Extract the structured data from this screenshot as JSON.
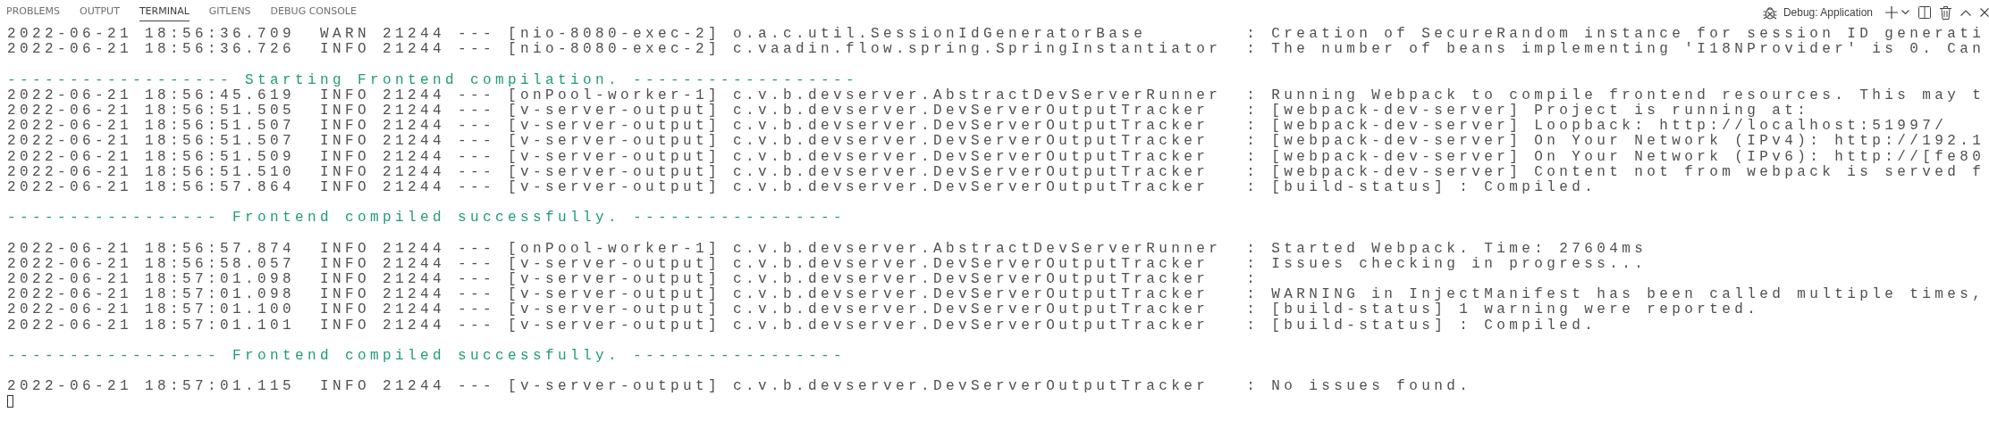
{
  "tabs": [
    {
      "label": "PROBLEMS",
      "selected": false
    },
    {
      "label": "OUTPUT",
      "selected": false
    },
    {
      "label": "TERMINAL",
      "selected": true
    },
    {
      "label": "GITLENS",
      "selected": false
    },
    {
      "label": "DEBUG CONSOLE",
      "selected": false
    }
  ],
  "toolbar": {
    "session": "Debug: Application"
  },
  "terminal": {
    "lines": [
      {
        "kind": "log",
        "text": "2022-06-21 18:56:36.709  WARN 21244 --- [nio-8080-exec-2] o.a.c.util.SessionIdGeneratorBase        : Creation of SecureRandom instance for session ID generati"
      },
      {
        "kind": "log",
        "text": "2022-06-21 18:56:36.726  INFO 21244 --- [nio-8080-exec-2] c.vaadin.flow.spring.SpringInstantiator  : The number of beans implementing 'I18NProvider' is 0. Can"
      },
      {
        "kind": "blank"
      },
      {
        "kind": "banner",
        "text": "------------------ Starting Frontend compilation. ------------------"
      },
      {
        "kind": "log",
        "text": "2022-06-21 18:56:45.619  INFO 21244 --- [onPool-worker-1] c.v.b.devserver.AbstractDevServerRunner  : Running Webpack to compile frontend resources. This may t"
      },
      {
        "kind": "log",
        "text": "2022-06-21 18:56:51.505  INFO 21244 --- [v-server-output] c.v.b.devserver.DevServerOutputTracker   : [webpack-dev-server] Project is running at:"
      },
      {
        "kind": "log",
        "text": "2022-06-21 18:56:51.507  INFO 21244 --- [v-server-output] c.v.b.devserver.DevServerOutputTracker   : [webpack-dev-server] Loopback: http://localhost:51997/"
      },
      {
        "kind": "log",
        "text": "2022-06-21 18:56:51.507  INFO 21244 --- [v-server-output] c.v.b.devserver.DevServerOutputTracker   : [webpack-dev-server] On Your Network (IPv4): http://192.1"
      },
      {
        "kind": "log",
        "text": "2022-06-21 18:56:51.509  INFO 21244 --- [v-server-output] c.v.b.devserver.DevServerOutputTracker   : [webpack-dev-server] On Your Network (IPv6): http://[fe80"
      },
      {
        "kind": "log",
        "text": "2022-06-21 18:56:51.510  INFO 21244 --- [v-server-output] c.v.b.devserver.DevServerOutputTracker   : [webpack-dev-server] Content not from webpack is served f"
      },
      {
        "kind": "log",
        "text": "2022-06-21 18:56:57.864  INFO 21244 --- [v-server-output] c.v.b.devserver.DevServerOutputTracker   : [build-status] : Compiled."
      },
      {
        "kind": "blank"
      },
      {
        "kind": "banner",
        "text": "----------------- Frontend compiled successfully. -----------------"
      },
      {
        "kind": "blank"
      },
      {
        "kind": "log",
        "text": "2022-06-21 18:56:57.874  INFO 21244 --- [onPool-worker-1] c.v.b.devserver.AbstractDevServerRunner  : Started Webpack. Time: 27604ms"
      },
      {
        "kind": "log",
        "text": "2022-06-21 18:56:58.057  INFO 21244 --- [v-server-output] c.v.b.devserver.DevServerOutputTracker   : Issues checking in progress..."
      },
      {
        "kind": "log",
        "text": "2022-06-21 18:57:01.098  INFO 21244 --- [v-server-output] c.v.b.devserver.DevServerOutputTracker   :"
      },
      {
        "kind": "log",
        "text": "2022-06-21 18:57:01.098  INFO 21244 --- [v-server-output] c.v.b.devserver.DevServerOutputTracker   : WARNING in InjectManifest has been called multiple times,"
      },
      {
        "kind": "log",
        "text": "2022-06-21 18:57:01.100  INFO 21244 --- [v-server-output] c.v.b.devserver.DevServerOutputTracker   : [build-status] 1 warning were reported."
      },
      {
        "kind": "log",
        "text": "2022-06-21 18:57:01.101  INFO 21244 --- [v-server-output] c.v.b.devserver.DevServerOutputTracker   : [build-status] : Compiled."
      },
      {
        "kind": "blank"
      },
      {
        "kind": "banner",
        "text": "----------------- Frontend compiled successfully. -----------------"
      },
      {
        "kind": "blank"
      },
      {
        "kind": "log",
        "text": "2022-06-21 18:57:01.115  INFO 21244 --- [v-server-output] c.v.b.devserver.DevServerOutputTracker   : No issues found."
      },
      {
        "kind": "cursor"
      }
    ]
  }
}
